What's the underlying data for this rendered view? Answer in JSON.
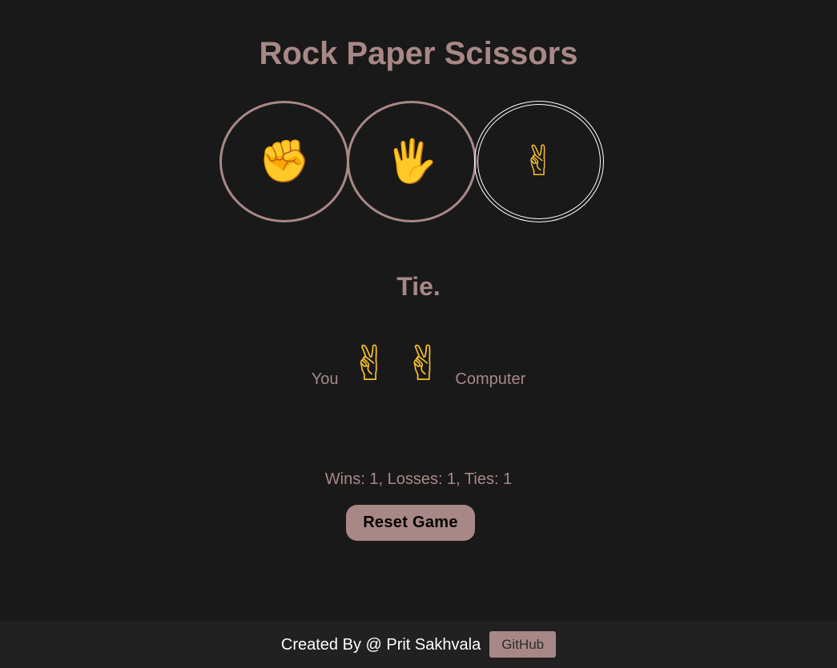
{
  "title": "Rock Paper Scissors",
  "choices": [
    {
      "name": "rock",
      "glyph": "✊",
      "icon": "raised-fist-icon",
      "selected": false
    },
    {
      "name": "paper",
      "glyph": "🖐",
      "icon": "raised-hand-icon",
      "selected": false
    },
    {
      "name": "scissors",
      "glyph": "✌",
      "icon": "victory-hand-icon",
      "selected": true
    }
  ],
  "result": {
    "text": "Tie.",
    "player_label": "You",
    "player_move": "✌",
    "computer_move": "✌",
    "computer_label": "Computer"
  },
  "score": {
    "text": "Wins: 1, Losses: 1, Ties: 1",
    "wins": 1,
    "losses": 1,
    "ties": 1
  },
  "reset_label": "Reset Game",
  "footer": {
    "credit": "Created By @ Prit Sakhvala",
    "github_label": "GitHub"
  },
  "colors": {
    "background": "#191919",
    "accent": "#a88887",
    "footer_bg": "#212121",
    "emoji": "#f6bd2c"
  }
}
